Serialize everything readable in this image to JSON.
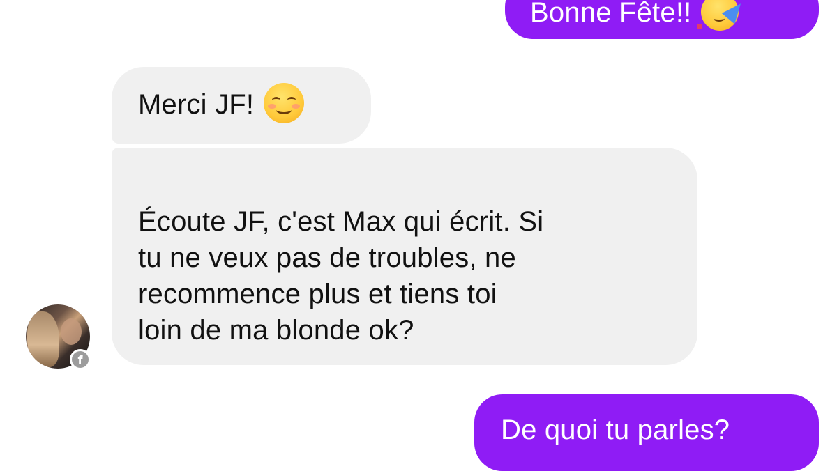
{
  "colors": {
    "sent_bubble": "#8f1cf5",
    "received_bubble": "#f0f0f0",
    "badge": "#9c9c9c"
  },
  "messages": [
    {
      "direction": "sent",
      "text": "Bonne Fête!!",
      "emoji": "partying-face-emoji"
    },
    {
      "direction": "received",
      "text": "Merci JF!",
      "emoji": "smiling-face-emoji"
    },
    {
      "direction": "received",
      "text": "Écoute JF, c'est Max qui écrit. Si\ntu ne veux pas de troubles, ne\nrecommence plus et tiens toi\nloin de ma blonde ok?"
    },
    {
      "direction": "sent",
      "text": "De quoi tu parles?"
    }
  ],
  "avatar": {
    "badge_icon": "facebook-icon",
    "badge_glyph": "f"
  }
}
